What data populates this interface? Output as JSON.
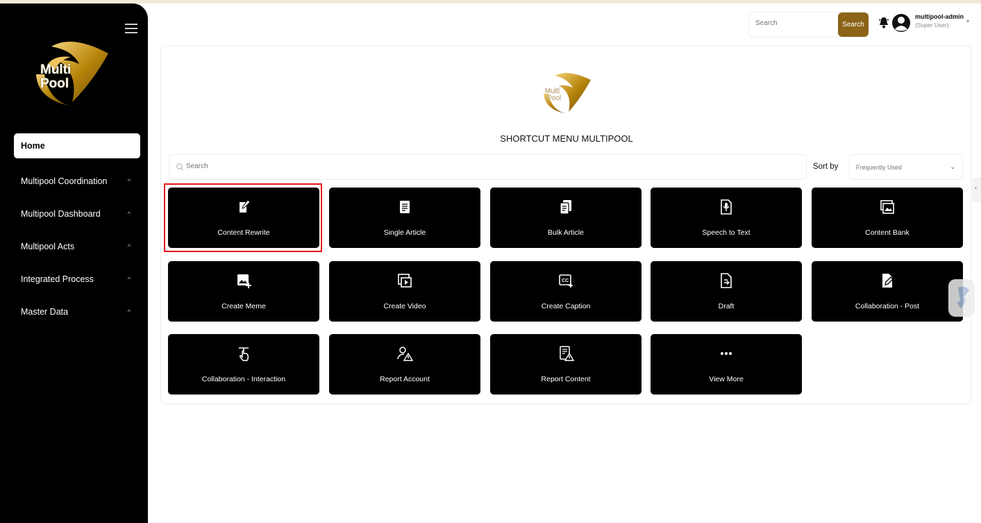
{
  "sidebar": {
    "logo_line1": "Multi",
    "logo_line2": "Pool",
    "items": [
      {
        "label": "Home",
        "active": true
      },
      {
        "label": "Multipool Coordination",
        "active": false
      },
      {
        "label": "Multipool Dashboard",
        "active": false
      },
      {
        "label": "Multipool Acts",
        "active": false
      },
      {
        "label": "Integrated Process",
        "active": false
      },
      {
        "label": "Master Data",
        "active": false
      }
    ]
  },
  "topbar": {
    "search_placeholder": "Search",
    "search_button": "Search",
    "user_name": "multipool-admin",
    "user_role": "(Super User)"
  },
  "main": {
    "title": "SHORTCUT MENU MULTIPOOL",
    "search_placeholder": "Search",
    "sort_label": "Sort by",
    "sort_value": "Frequently Used"
  },
  "tiles": [
    {
      "label": "Content Rewrite",
      "icon": "edit-note-icon"
    },
    {
      "label": "Single Article",
      "icon": "article-icon"
    },
    {
      "label": "Bulk Article",
      "icon": "bulk-article-icon"
    },
    {
      "label": "Speech to Text",
      "icon": "speech-to-text-icon"
    },
    {
      "label": "Content Bank",
      "icon": "content-bank-icon"
    },
    {
      "label": "Create Meme",
      "icon": "add-image-icon"
    },
    {
      "label": "Create Video",
      "icon": "video-icon"
    },
    {
      "label": "Create Caption",
      "icon": "caption-icon"
    },
    {
      "label": "Draft",
      "icon": "draft-icon"
    },
    {
      "label": "Collaboration - Post",
      "icon": "collaboration-post-icon"
    },
    {
      "label": "Collaboration - Interaction",
      "icon": "touch-icon"
    },
    {
      "label": "Report Account",
      "icon": "report-account-icon"
    },
    {
      "label": "Report Content",
      "icon": "report-content-icon"
    },
    {
      "label": "View More",
      "icon": "more-icon"
    }
  ],
  "colors": {
    "accent": "#8b6418",
    "sidebar_bg": "#000000",
    "highlight": "#e3151a"
  }
}
